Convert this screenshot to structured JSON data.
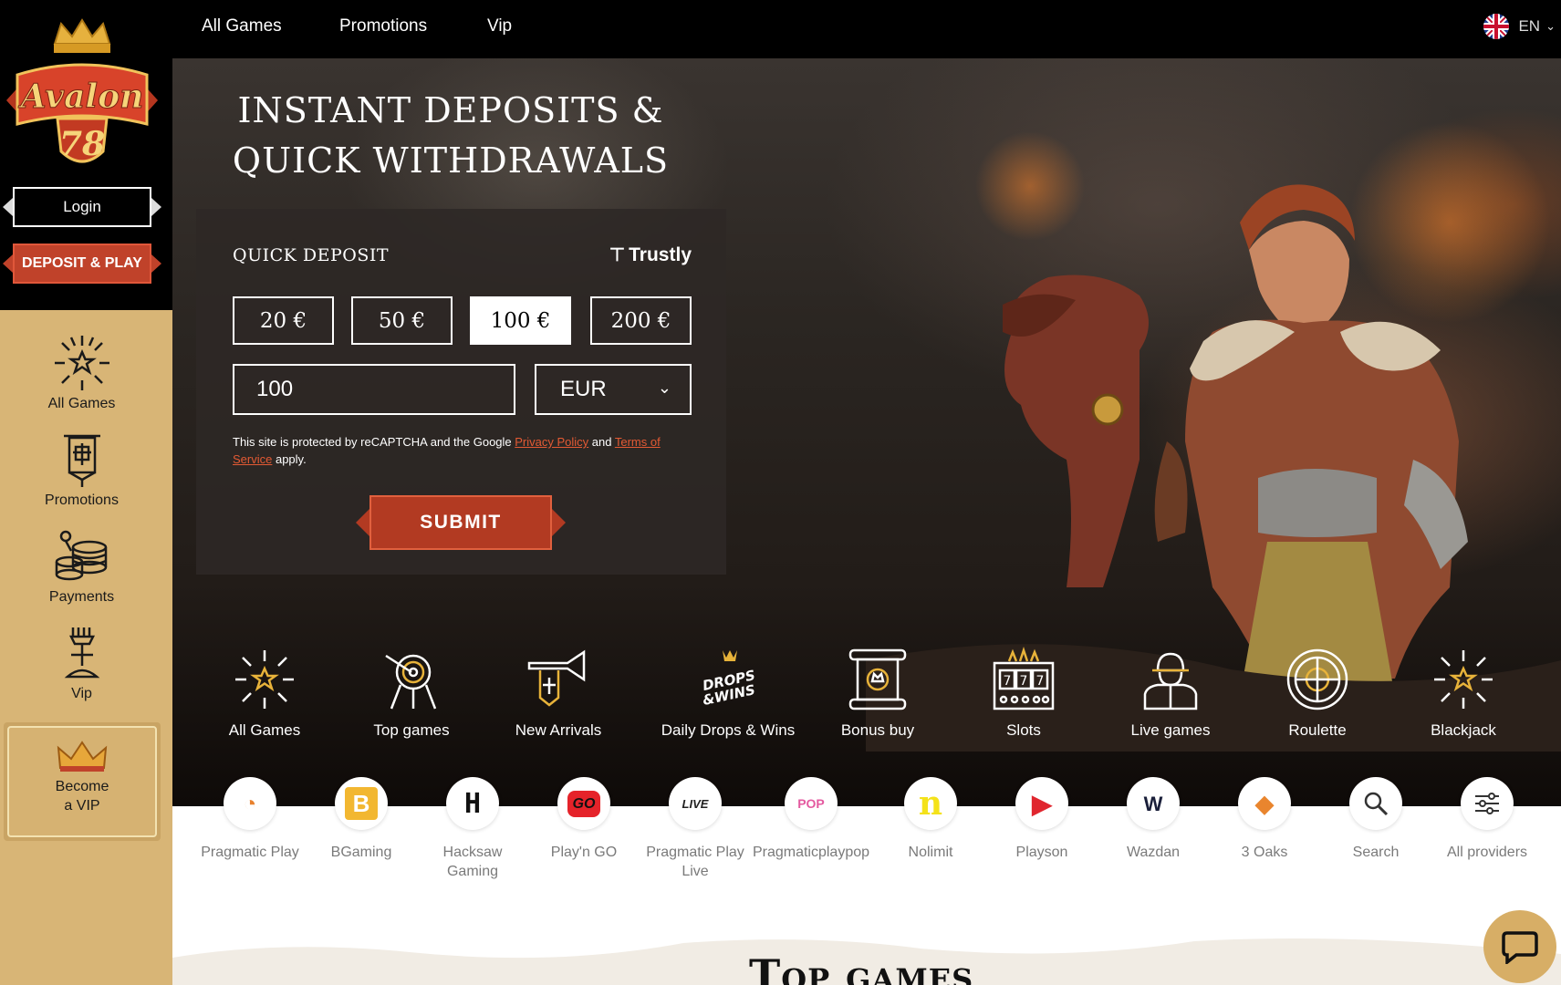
{
  "brand": {
    "name_line1": "Avalon",
    "name_line2": "78"
  },
  "sidebar": {
    "login_label": "Login",
    "deposit_label": "DEPOSIT & PLAY",
    "items": [
      {
        "label": "All Games",
        "icon": "starburst-icon"
      },
      {
        "label": "Promotions",
        "icon": "banner-icon"
      },
      {
        "label": "Payments",
        "icon": "coins-icon"
      },
      {
        "label": "Vip",
        "icon": "sword-icon"
      }
    ],
    "vip_card": {
      "line1": "Become",
      "line2": "a VIP",
      "icon": "crown-icon"
    }
  },
  "topnav": {
    "links": [
      "All Games",
      "Promotions",
      "Vip"
    ],
    "language": "EN"
  },
  "hero": {
    "title_line1": "INSTANT DEPOSITS &",
    "title_line2": "QUICK WITHDRAWALS"
  },
  "quick_deposit": {
    "title": "QUICK DEPOSIT",
    "provider": "Trustly",
    "amounts": [
      "20 €",
      "50 €",
      "100 €",
      "200 €"
    ],
    "selected_amount": "100 €",
    "amount_value": "100",
    "currency": "EUR",
    "recaptcha_text_1": "This site is protected by reCAPTCHA and the Google ",
    "privacy_link": "Privacy Policy",
    "recaptcha_text_2": " and ",
    "terms_link_1": "Terms of",
    "terms_link_2": "Service",
    "recaptcha_text_3": " apply.",
    "submit_label": "SUBMIT",
    "accent_color": "#b23a22"
  },
  "categories": [
    "All Games",
    "Top games",
    "New Arrivals",
    "Daily Drops & Wins",
    "Bonus buy",
    "Slots",
    "Live games",
    "Roulette",
    "Blackjack"
  ],
  "daily_drops_badge": [
    "DROPS",
    "&WINS"
  ],
  "providers": [
    {
      "label": "Pragmatic Play",
      "line2": "",
      "glyph": "◔",
      "color": "#e8812e"
    },
    {
      "label": "BGaming",
      "line2": "",
      "glyph": "B",
      "color": "#f2b731"
    },
    {
      "label": "Hacksaw",
      "line2": "Gaming",
      "glyph": "H",
      "color": "#111111"
    },
    {
      "label": "Play'n GO",
      "line2": "",
      "glyph": "GO",
      "color": "#e5232a"
    },
    {
      "label": "Pragmatic Play",
      "line2": "Live",
      "glyph": "LIVE",
      "color": "#222222"
    },
    {
      "label": "Pragmaticplaypop",
      "line2": "",
      "glyph": "POP",
      "color": "#e45aa0"
    },
    {
      "label": "Nolimit",
      "line2": "",
      "glyph": "n",
      "color": "#f4e21a"
    },
    {
      "label": "Playson",
      "line2": "",
      "glyph": "▶",
      "color": "#e0262f"
    },
    {
      "label": "Wazdan",
      "line2": "",
      "glyph": "W",
      "color": "#1a1f3a"
    },
    {
      "label": "3 Oaks",
      "line2": "",
      "glyph": "◆",
      "color": "#e9852e"
    },
    {
      "label": "Search",
      "line2": "",
      "glyph": "⌕",
      "color": "#333333"
    },
    {
      "label": "All providers",
      "line2": "",
      "glyph": "≡",
      "color": "#333333"
    }
  ],
  "section_title": "Top games"
}
